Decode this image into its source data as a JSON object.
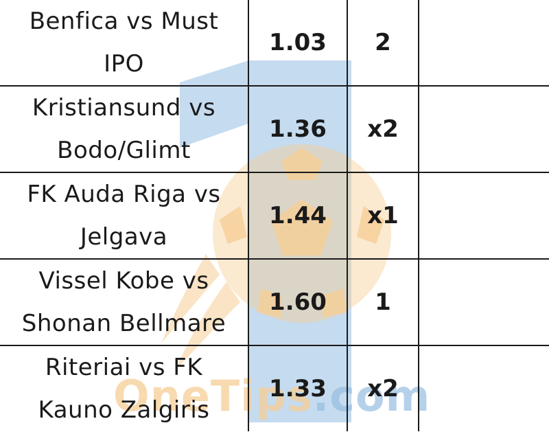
{
  "rows": [
    {
      "match_line1": "Benfica vs Must",
      "match_line2": "IPO",
      "odds": "1.03",
      "tip": "2"
    },
    {
      "match_line1": "Kristiansund vs",
      "match_line2": "Bodo/Glimt",
      "odds": "1.36",
      "tip": "x2"
    },
    {
      "match_line1": "FK Auda Riga vs",
      "match_line2": "Jelgava",
      "odds": "1.44",
      "tip": "x1"
    },
    {
      "match_line1": "Vissel Kobe vs",
      "match_line2": "Shonan Bellmare",
      "odds": "1.60",
      "tip": "1"
    },
    {
      "match_line1": "Riteriai vs FK",
      "match_line2": "Kauno Zalgiris",
      "odds": "1.33",
      "tip": "x2"
    }
  ],
  "watermark": {
    "text_part1": "OneTips",
    "text_part2": ".com",
    "ball_color": "#f6ce96",
    "logo_color": "#96bee1"
  }
}
